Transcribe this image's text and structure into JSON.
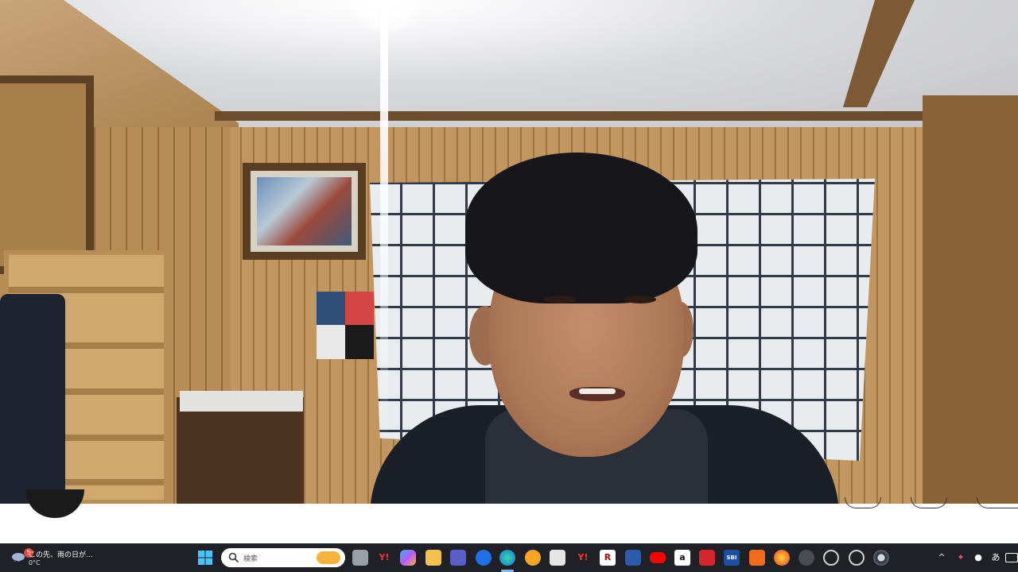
{
  "window": {
    "type": "video-call"
  },
  "taskbar": {
    "weather": {
      "icon": "cloud-rain-icon",
      "badge": "5",
      "text": "この先、雨の日が...",
      "temp": "0°C"
    },
    "search": {
      "placeholder": "検索"
    },
    "apps": [
      {
        "name": "start-icon"
      },
      {
        "name": "task-view-icon"
      },
      {
        "name": "yahoo-icon",
        "label": "Y!"
      },
      {
        "name": "copilot-icon"
      },
      {
        "name": "file-explorer-icon"
      },
      {
        "name": "teams-icon"
      },
      {
        "name": "dropbox-icon"
      },
      {
        "name": "edge-icon"
      },
      {
        "name": "circle-app-icon"
      },
      {
        "name": "store-icon"
      },
      {
        "name": "yahoo-alt-icon",
        "label": "Y!"
      },
      {
        "name": "rakuten-icon",
        "label": "R"
      },
      {
        "name": "news-app-icon"
      },
      {
        "name": "youtube-icon"
      },
      {
        "name": "amazon-icon",
        "label": "a"
      },
      {
        "name": "red-app-icon"
      },
      {
        "name": "sbi-icon",
        "label": "SBI"
      },
      {
        "name": "orange-app-icon"
      },
      {
        "name": "firefox-icon"
      },
      {
        "name": "game-controller-icon"
      },
      {
        "name": "settings-gear-icon"
      },
      {
        "name": "settings-alt-icon"
      },
      {
        "name": "camera-app-icon"
      }
    ],
    "tray": {
      "chevron": "^",
      "ime": "あ"
    }
  },
  "colors": {
    "taskbar_bg": "#1f2126",
    "search_bg": "#ffffff",
    "active_indicator": "#7dbdf0",
    "badge": "#e0443a"
  }
}
